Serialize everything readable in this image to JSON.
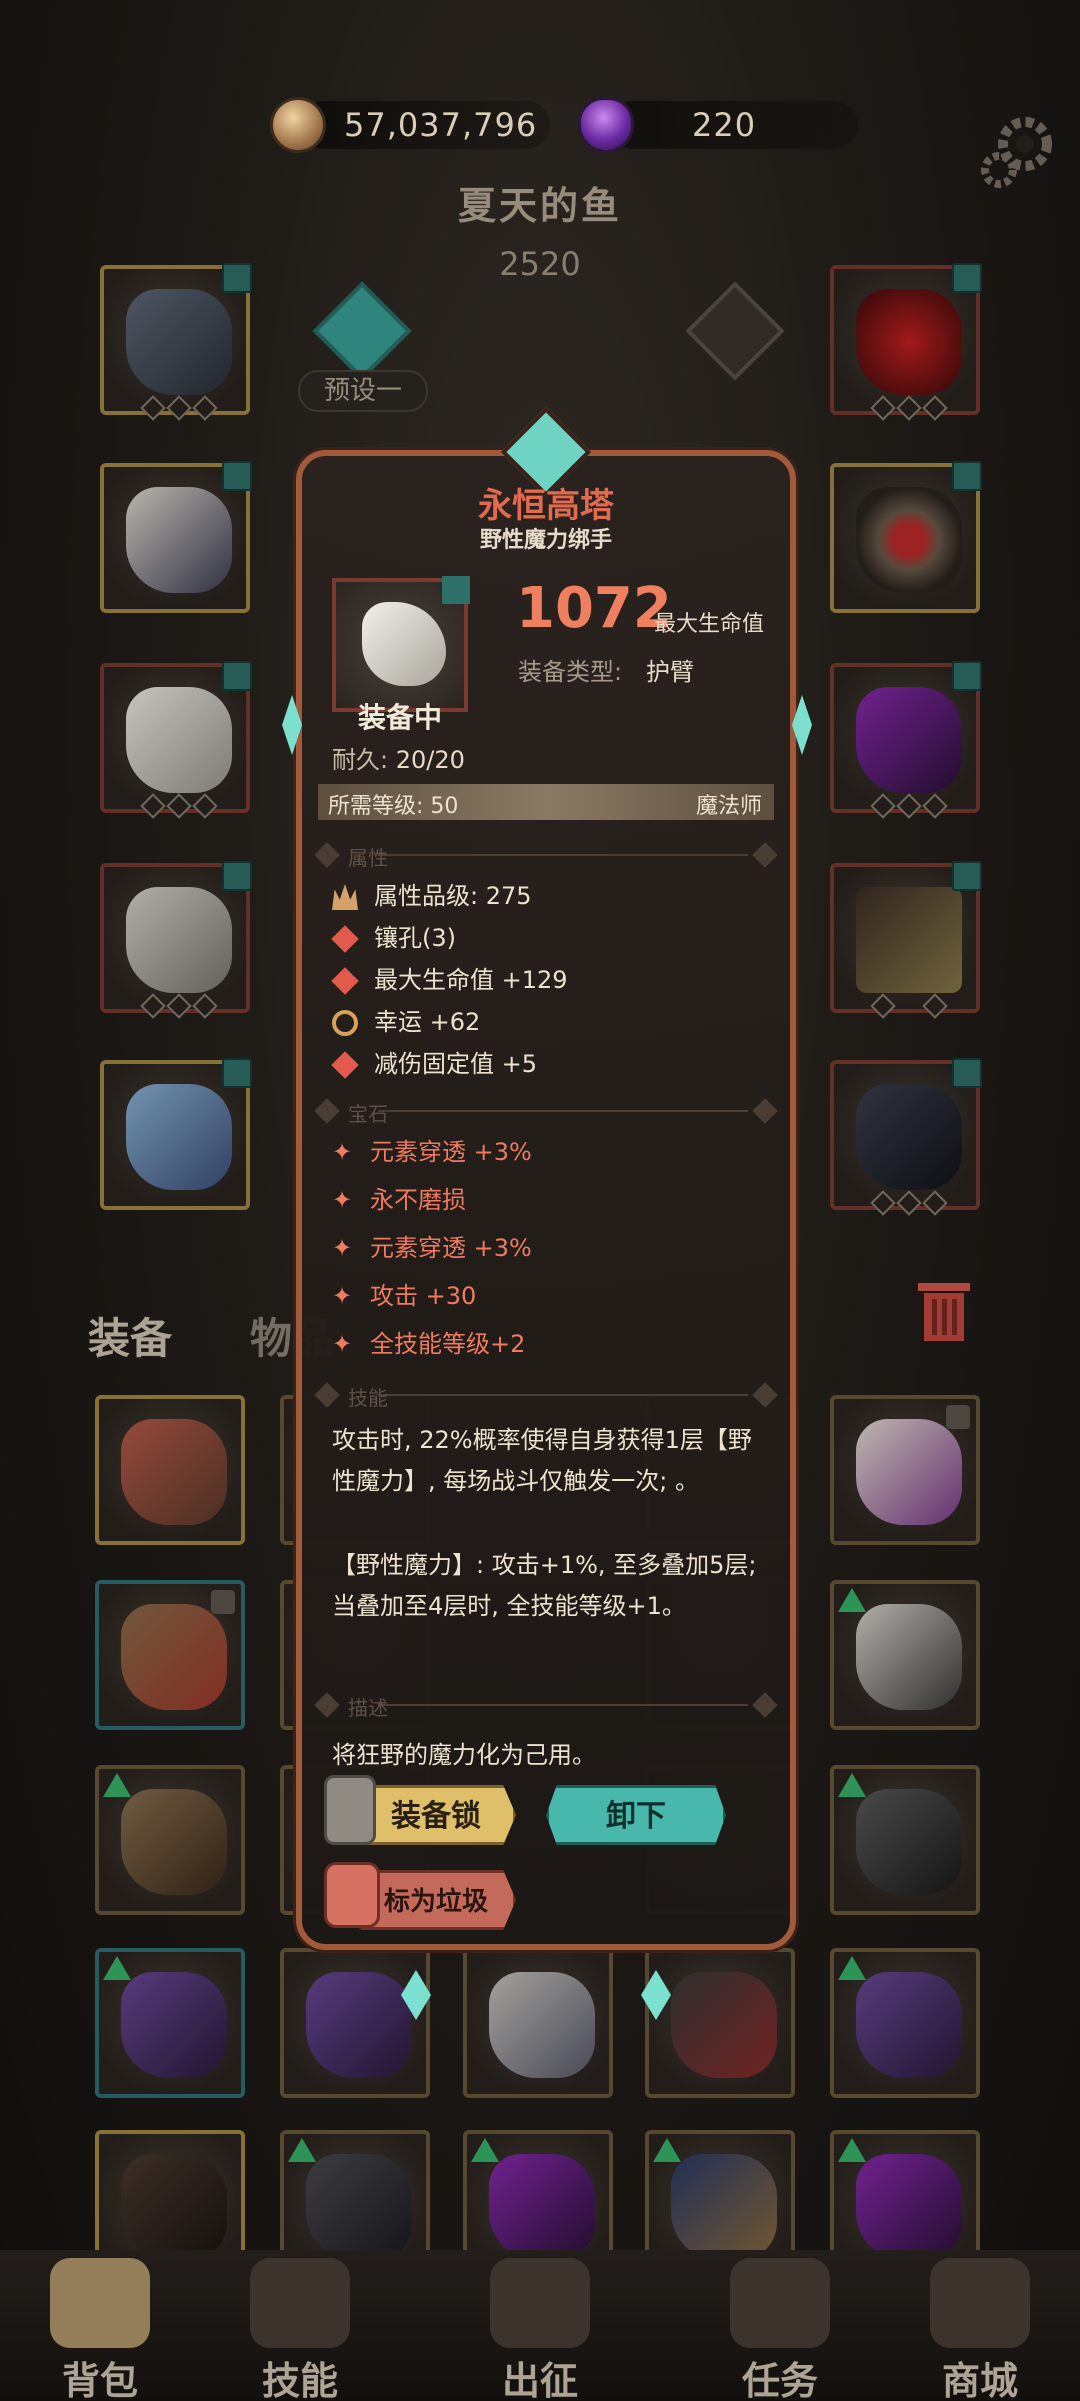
{
  "currency": {
    "gold_value": "57,037,796",
    "gem_value": "220",
    "gold_icon": "coin-icon",
    "gem_icon": "purple-crystal-icon"
  },
  "player": {
    "name": "夏天的鱼",
    "power": "2520",
    "preset_label": "预设一"
  },
  "tabs": {
    "equipment": "装备",
    "items": "物品"
  },
  "bottom_nav": [
    {
      "label": "背包",
      "icon": "backpack-icon"
    },
    {
      "label": "技能",
      "icon": "skill-book-icon"
    },
    {
      "label": "出征",
      "icon": "map-icon"
    },
    {
      "label": "任务",
      "icon": "quest-icon"
    },
    {
      "label": "商城",
      "icon": "shop-icon"
    }
  ],
  "tooltip": {
    "title": "永恒高塔",
    "subtitle": "野性魔力绑手",
    "main_value": "1072",
    "main_value_unit": "最大生命值",
    "type_label": "装备类型:",
    "type_value": "护臂",
    "equipped_label": "装备中",
    "durability_label": "耐久:",
    "durability_value": "20/20",
    "required_level": "所需等级: 50",
    "class": "魔法师",
    "section_attributes": "属性",
    "attributes": [
      {
        "icon": "crown-icon",
        "text": "属性品级: 275"
      },
      {
        "icon": "socket-icon",
        "text": "镶孔(3)"
      },
      {
        "icon": "stat-diamond-icon",
        "text": "最大生命值 +129"
      },
      {
        "icon": "luck-icon",
        "text": "幸运 +62"
      },
      {
        "icon": "stat-diamond-icon",
        "text": "减伤固定值 +5"
      }
    ],
    "section_gems": "宝石",
    "gems": [
      "元素穿透 +3%",
      "永不磨损",
      "元素穿透 +3%",
      "攻击 +30",
      "全技能等级+2"
    ],
    "section_skill": "技能",
    "skill_text_1": "攻击时, 22%概率使得自身获得1层【野性魔力】, 每场战斗仅触发一次; 。",
    "skill_text_2": "【野性魔力】: 攻击+1%, 至多叠加5层; 当叠加至4层时, 全技能等级+1。",
    "section_desc": "描述",
    "description": "将狂野的魔力化为己用。",
    "btn_lock": "装备锁",
    "btn_unequip": "卸下",
    "btn_junk": "标为垃圾"
  },
  "colors": {
    "accent_red": "#e26a4e",
    "teal": "#49b8ac",
    "gold": "#e0bf6b"
  }
}
